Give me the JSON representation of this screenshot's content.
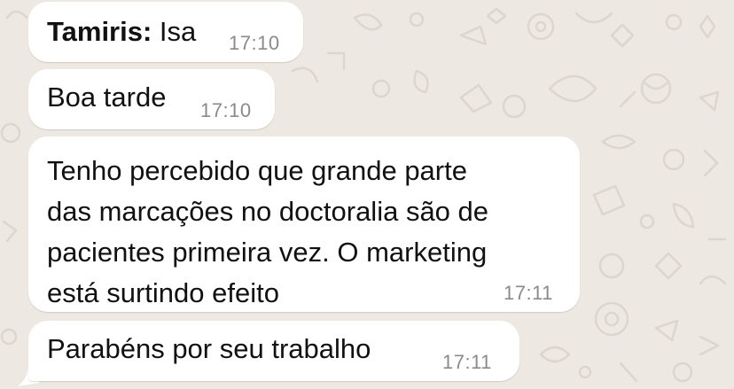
{
  "chat": {
    "messages": [
      {
        "sender": "Tamiris:",
        "text": "Isa",
        "time": "17:10"
      },
      {
        "text": "Boa tarde",
        "time": "17:10"
      },
      {
        "lines": [
          "Tenho percebido que grande parte",
          "das marcações no doctoralia são de",
          "pacientes primeira vez. O marketing",
          "está surtindo efeito"
        ],
        "time": "17:11"
      },
      {
        "text": "Parabéns por seu trabalho",
        "time": "17:11"
      }
    ]
  },
  "colors": {
    "wallpaper": "#ede8e1",
    "bubble": "#ffffff",
    "text": "#111111",
    "timestamp": "#8a8a8a"
  }
}
